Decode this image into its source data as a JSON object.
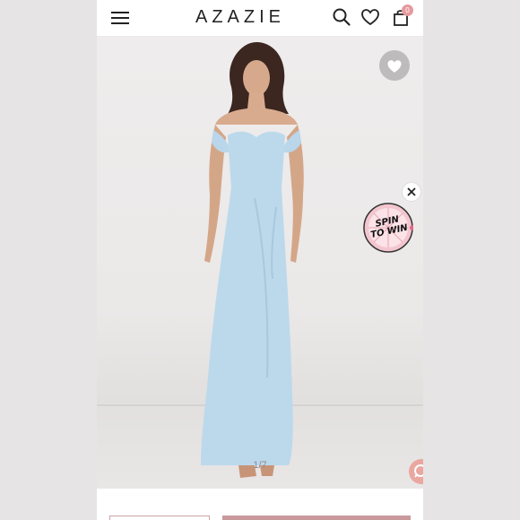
{
  "header": {
    "brand": "AZAZIE",
    "menu_icon": "hamburger-menu-icon",
    "search_icon": "search-icon",
    "wishlist_icon": "heart-outline-icon",
    "cart_icon": "shopping-bag-icon",
    "cart_count": "0"
  },
  "gallery": {
    "image_counter": "1/7",
    "wishlist_button_icon": "heart-icon",
    "product_color": "#bcd9ec"
  },
  "promo": {
    "line1": "SPIN",
    "line2": "TO WIN",
    "close_icon": "close-icon"
  },
  "chat": {
    "icon": "chat-bubble-icon"
  },
  "colors": {
    "brand_pink": "#c9999c",
    "badge_pink": "#e59a9d",
    "dress_blue": "#bcd9ec"
  }
}
